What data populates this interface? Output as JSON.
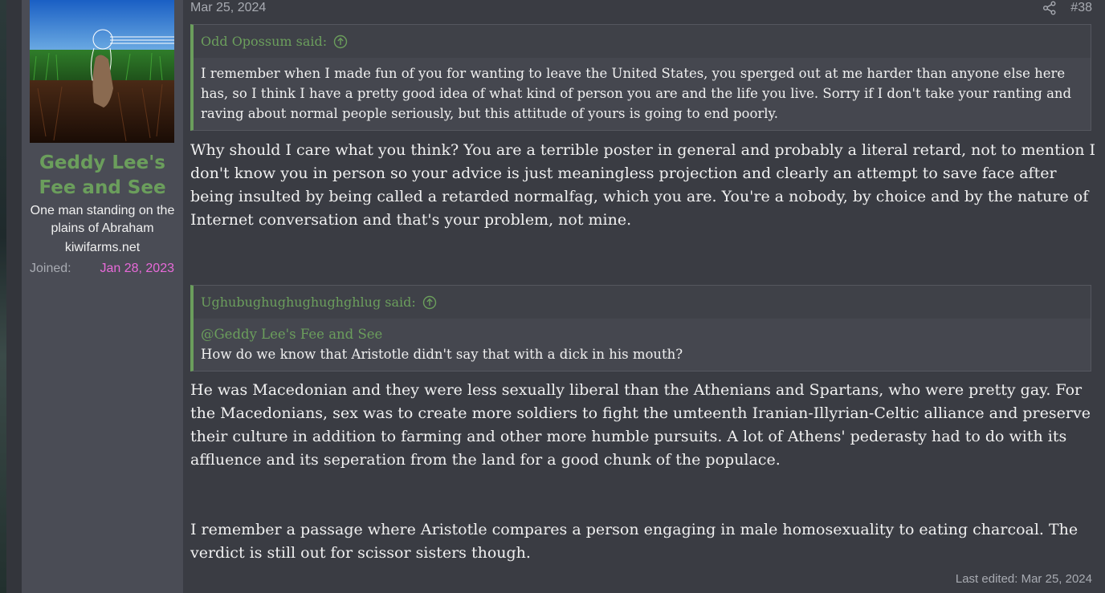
{
  "user": {
    "name": "Geddy Lee's Fee and See",
    "title": "One man standing on the plains of Abraham",
    "banner": "kiwifarms.net",
    "joined_label": "Joined:",
    "joined_value": "Jan 28, 2023"
  },
  "post": {
    "date": "Mar 25, 2024",
    "number": "#38",
    "quotes": [
      {
        "author": "Odd Opossum said:",
        "mention": "",
        "text": "I remember when I made fun of you for wanting to leave the United States, you sperged out at me harder than anyone else here has, so I think I have a pretty good idea of what kind of person you are and the life you live. Sorry if I don't take your ranting and raving about normal people seriously, but this attitude of yours is going to end poorly."
      },
      {
        "author": "Ughubughughughughghlug said:",
        "mention": "@Geddy Lee's Fee and See",
        "text": "How do we know that Aristotle didn't say that with a dick in his mouth?"
      }
    ],
    "replies": [
      "Why should I care what you think? You are a terrible poster in general and probably a literal retard, not to mention I don't know you in person so your advice is just meaningless projection and clearly an attempt to save face after being insulted by being called a retarded normalfag, which you are. You're a nobody, by choice and by the nature of Internet conversation and that's your problem, not mine.",
      "He was Macedonian and they were less sexually liberal than the Athenians and Spartans, who were pretty gay. For the Macedonians, sex was to create more soldiers to fight the umteenth Iranian-Illyrian-Celtic alliance and preserve their culture in addition to farming and other more humble pursuits. A lot of Athens' pederasty had to do with its affluence and its seperation from the land for a good chunk of the populace.",
      "I remember a passage where Aristotle compares a person engaging in male homosexuality to eating charcoal. The verdict is still out for scissor sisters though."
    ],
    "last_edited": "Last edited: Mar 25, 2024"
  },
  "icons": {
    "share": "share-icon",
    "quote_jump": "arrow-up-circle-icon"
  },
  "colors": {
    "accent_green": "#6b9e5c",
    "joined_pink": "#e86ad9",
    "text": "#f0f0f0",
    "muted": "#a8abb2"
  }
}
